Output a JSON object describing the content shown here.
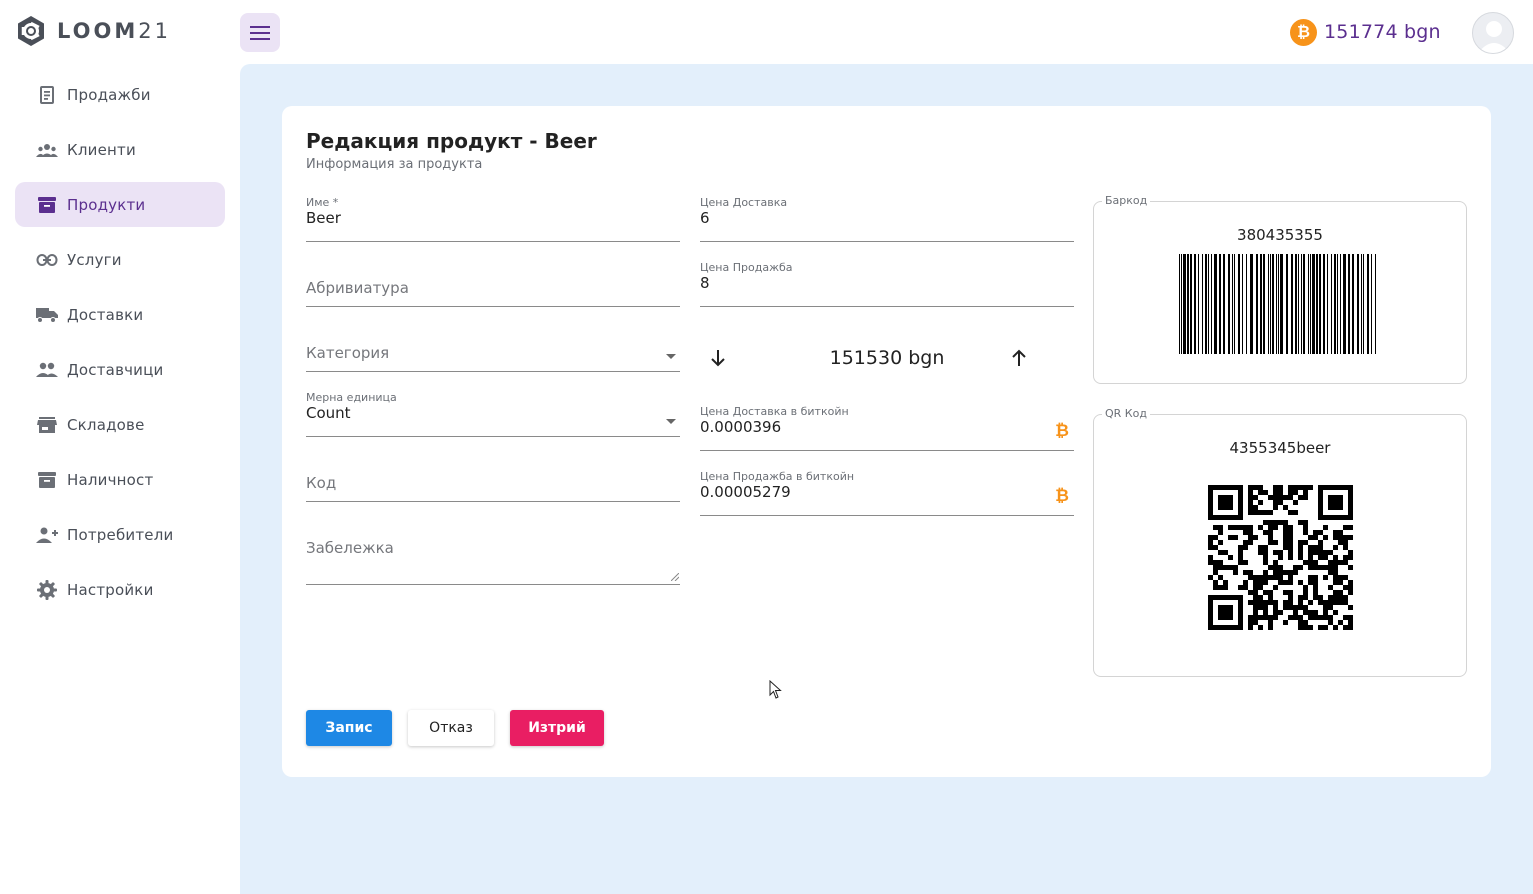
{
  "brand": {
    "name": "LOOM",
    "number": "21"
  },
  "header": {
    "balance": "151774 bgn",
    "btc_symbol": "₿"
  },
  "nav": [
    {
      "label": "Продажби",
      "icon": "receipt-icon"
    },
    {
      "label": "Клиенти",
      "icon": "groups-icon"
    },
    {
      "label": "Продукти",
      "icon": "inventory-box-icon",
      "active": true
    },
    {
      "label": "Услуги",
      "icon": "link-icon"
    },
    {
      "label": "Доставки",
      "icon": "truck-icon"
    },
    {
      "label": "Доставчици",
      "icon": "people-icon"
    },
    {
      "label": "Складове",
      "icon": "store-icon"
    },
    {
      "label": "Наличност",
      "icon": "archive-icon"
    },
    {
      "label": "Потребители",
      "icon": "person-add-icon"
    },
    {
      "label": "Настройки",
      "icon": "gear-icon"
    }
  ],
  "form": {
    "title": "Редакция продукт - Beer",
    "subtitle": "Информация за продукта",
    "name": {
      "label": "Име *",
      "value": "Beer"
    },
    "abbreviation": {
      "placeholder": "Абривиатура"
    },
    "category": {
      "placeholder": "Категория"
    },
    "unit": {
      "label": "Мерна единица",
      "value": "Count"
    },
    "code": {
      "placeholder": "Код"
    },
    "note": {
      "placeholder": "Забележка"
    },
    "delivery_price": {
      "label": "Цена Доставка",
      "value": "6"
    },
    "sale_price": {
      "label": "Цена Продажба",
      "value": "8"
    },
    "conversion": {
      "value": "151530 bgn"
    },
    "delivery_price_btc": {
      "label": "Цена Доставка в биткойн",
      "value": "0.0000396"
    },
    "sale_price_btc": {
      "label": "Цена Продажба в биткойн",
      "value": "0.00005279"
    },
    "barcode": {
      "legend": "Баркод",
      "value": "380435355"
    },
    "qrcode": {
      "legend": "QR Код",
      "value": "4355345beer"
    }
  },
  "buttons": {
    "save": "Запис",
    "cancel": "Отказ",
    "delete": "Изтрий"
  },
  "colors": {
    "accent": "#5b2f8f",
    "active_bg": "#ebe3f5",
    "content_bg": "#e3effb",
    "save": "#1e88e5",
    "delete": "#e91e63",
    "bitcoin": "#f7931a"
  }
}
